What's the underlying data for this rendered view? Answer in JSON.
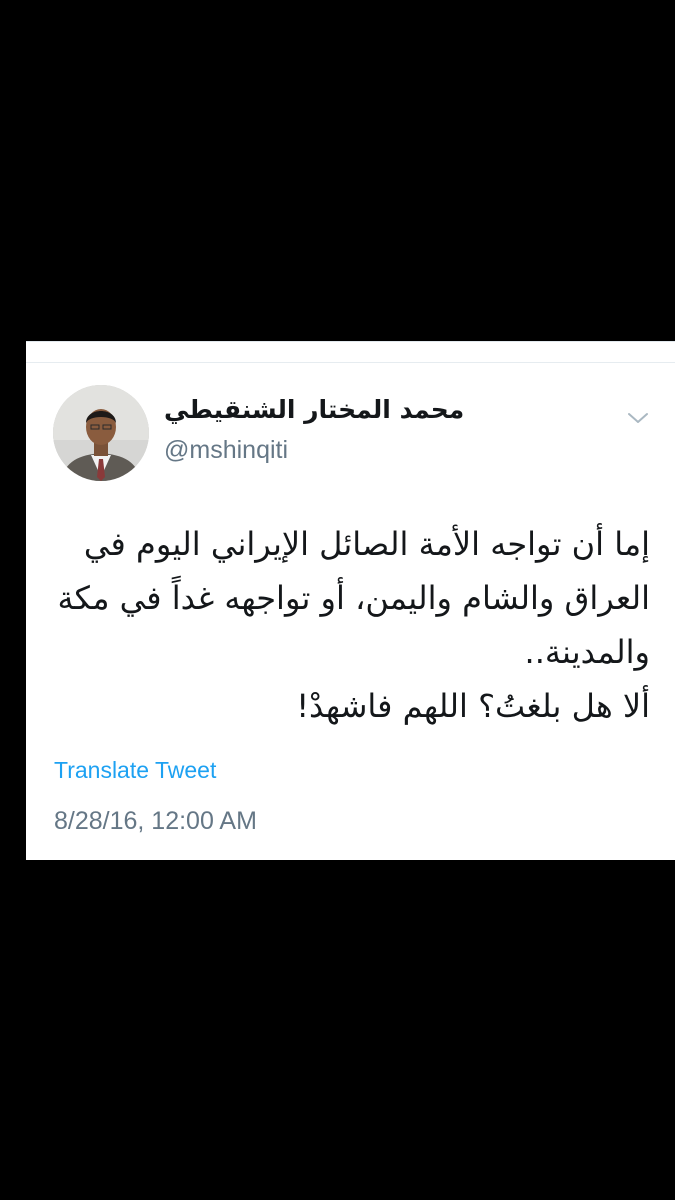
{
  "tweet": {
    "author_name": "محمد المختار الشنقيطي",
    "handle": "@mshinqiti",
    "text_lines": [
      "إما أن تواجه الأمة الصائل الإيراني اليوم في",
      "العراق والشام واليمن، أو تواجهه غداً في مكة",
      "والمدينة..",
      "ألا هل بلغتُ؟ اللهم فاشهدْ!"
    ],
    "translate_label": "Translate Tweet",
    "timestamp": "8/28/16, 12:00 AM"
  },
  "icons": {
    "menu": "chevron-down-icon",
    "avatar": "avatar"
  },
  "colors": {
    "background": "#000000",
    "card": "#ffffff",
    "link": "#1da1f2",
    "secondary_text": "#657786",
    "primary_text": "#14171a"
  }
}
